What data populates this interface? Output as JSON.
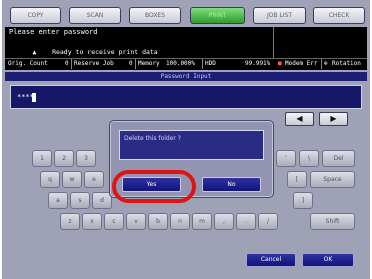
{
  "tabs": [
    {
      "label": "COPY"
    },
    {
      "label": "SCAN"
    },
    {
      "label": "BOXES"
    },
    {
      "label": "PRINT"
    },
    {
      "label": "JOB LIST"
    },
    {
      "label": "CHECK"
    }
  ],
  "status": {
    "prompt": "Please enter password",
    "ready": "Ready to receive print data",
    "orig_count": "Orig. Count",
    "orig_count_value": "0",
    "reserve_job": "Reserve Job",
    "reserve_job_value": "0",
    "memory": "Memory",
    "memory_value": "100.000%",
    "hdd": "HDD",
    "hdd_value": "99.991%",
    "modem": "Modem Err",
    "rotation": "Rotation"
  },
  "password": {
    "title": "Password Input",
    "value": "****"
  },
  "arrows": {
    "left": "◀",
    "right": "▶"
  },
  "keyboard": {
    "row1": [
      "1",
      "2",
      "3",
      "'",
      "\\",
      "Del"
    ],
    "row2": [
      "q",
      "w",
      "e",
      "[",
      "Space"
    ],
    "row3": [
      "a",
      "s",
      "d",
      "]"
    ],
    "row4": [
      "z",
      "x",
      "c",
      "v",
      "b",
      "n",
      "m",
      ",",
      ".",
      "/",
      "Shift"
    ]
  },
  "dialog": {
    "message": "Delete this folder ?",
    "yes": "Yes",
    "no": "No"
  },
  "footer": {
    "cancel": "Cancel",
    "ok": "OK"
  },
  "colors": {
    "highlight": "#e01414",
    "active_tab": "#2f9a33",
    "dialog_button": "#12137a"
  }
}
